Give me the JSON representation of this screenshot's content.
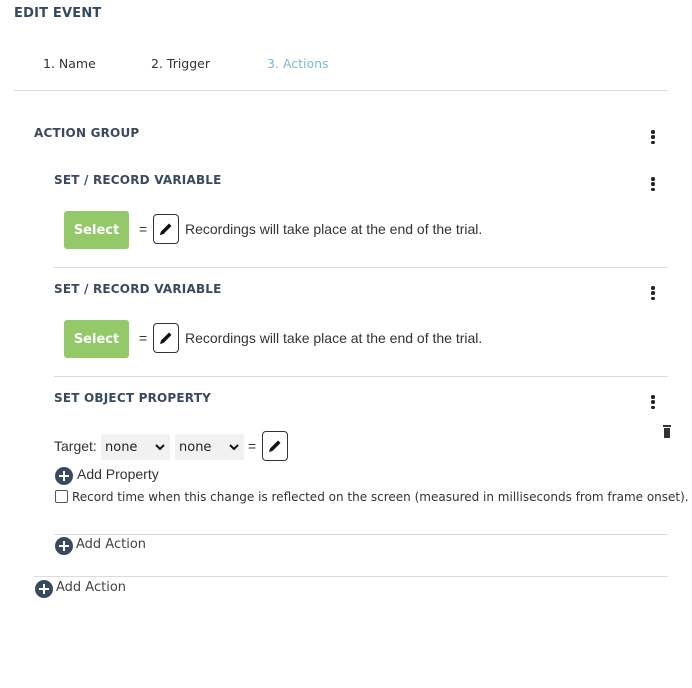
{
  "header": {
    "title": "EDIT EVENT"
  },
  "tabs": [
    {
      "label": "1. Name"
    },
    {
      "label": "2. Trigger"
    },
    {
      "label": "3. Actions",
      "active": true
    }
  ],
  "action_group": {
    "label": "ACTION GROUP",
    "actions": [
      {
        "label": "SET / RECORD VARIABLE",
        "select_label": "Select",
        "equals": "=",
        "description": "Recordings will take place at the end of the trial."
      },
      {
        "label": "SET / RECORD VARIABLE",
        "select_label": "Select",
        "equals": "=",
        "description": "Recordings will take place at the end of the trial."
      },
      {
        "label": "SET OBJECT PROPERTY",
        "target_label": "Target:",
        "target_object": "none",
        "target_property": "none",
        "equals": "=",
        "add_property_label": "Add Property",
        "record_time_label": "Record time when this change is reflected on the screen (measured in milliseconds from frame onset).",
        "record_time_checked": false
      }
    ],
    "add_action_label": "Add Action"
  },
  "add_action_label": "Add Action",
  "colors": {
    "accent_tab": "#7fb6d1",
    "select_button": "#94c96a",
    "heading": "#3a4a5e",
    "plus_icon": "#3a4a5e"
  },
  "icons": {
    "menu": "kebab-menu-icon",
    "edit": "pencil-icon",
    "add": "plus-circle-icon",
    "delete": "trash-icon",
    "dropdown": "chevron-down-icon"
  }
}
